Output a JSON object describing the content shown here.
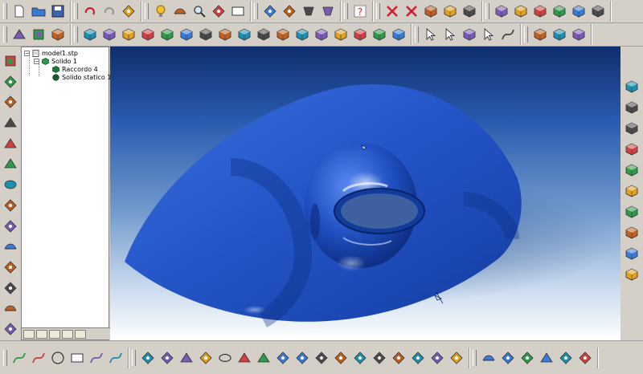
{
  "toolbar_top": [
    [
      "new-document-icon",
      "open-folder-icon",
      "save-icon"
    ],
    [
      "undo-icon",
      "redo-icon",
      "properties-icon"
    ],
    [
      "light-bulb-icon",
      "move-icon",
      "zoom-icon",
      "transform-icon",
      "grid-icon"
    ],
    [
      "render-icon",
      "wireframe-icon",
      "shaded-icon",
      "glasses-icon"
    ],
    [
      "help-icon"
    ],
    [
      "delete-red-icon",
      "delete-star-icon",
      "edit-solid-icon",
      "copy-solid-icon",
      "move-solid-icon"
    ],
    [
      "solid-view1-icon",
      "solid-view2-icon",
      "solid-view3-icon",
      "solid-view4-icon",
      "solid-view5-icon",
      "solid-view6-icon"
    ]
  ],
  "toolbar_second": [
    [
      "snap-icon",
      "section-icon",
      "solid-grid-icon"
    ],
    [
      "cube-1-icon",
      "cube-2-icon",
      "cube-3-icon",
      "cube-4-icon",
      "cube-5-icon",
      "cube-6-icon",
      "cube-7-icon",
      "cube-8-icon",
      "cube-9-icon",
      "cube-10-icon",
      "cube-11-icon",
      "cube-12-icon",
      "cube-13-icon",
      "cube-14-icon",
      "cube-15-icon",
      "cube-16-icon",
      "cube-17-icon"
    ],
    [
      "select-pointer-icon",
      "select-face-icon",
      "select-solid-icon",
      "select-edge-icon",
      "curve-icon"
    ],
    [
      "render-cube-1-icon",
      "render-cube-2-icon",
      "render-cube-3-icon"
    ]
  ],
  "toolbar_left": [
    "plane-icon",
    "face-icon",
    "shell-icon",
    "revolve-icon",
    "sweep-icon",
    "extrude-icon",
    "loft-icon",
    "boolean-icon",
    "fillet-icon",
    "chamfer-icon",
    "pattern-icon",
    "mirror-icon",
    "offset-icon",
    "split-icon"
  ],
  "toolbar_right": [
    "view-front-icon",
    "view-back-icon",
    "view-left-icon",
    "view-right-icon",
    "view-top-icon",
    "view-bottom-icon",
    "view-iso-icon",
    "view-cabinet-icon",
    "view-arch-icon",
    "view-box-icon"
  ],
  "toolbar_bottom": [
    [
      "curve-s-icon",
      "line-icon",
      "circle-icon",
      "rectangle-icon",
      "arc-icon",
      "spline-icon"
    ],
    [
      "surface-1-icon",
      "surface-2-icon",
      "polygon-icon",
      "surface-3-icon",
      "ellipse-icon",
      "surface-4-icon",
      "surface-5-icon",
      "cylinder-icon",
      "surface-6-icon",
      "surface-7-icon",
      "surface-8-icon",
      "surface-9-icon",
      "surface-10-icon",
      "surface-11-icon",
      "surface-12-icon",
      "surface-13-icon",
      "surface-14-icon"
    ],
    [
      "erase-icon",
      "dimension-icon",
      "constraint-icon",
      "measure-icon",
      "layer-icon",
      "export-icon"
    ]
  ],
  "tree": {
    "root": "model1.stp",
    "solid": "Solido 1",
    "fillet": "Raccordo 4",
    "static": "Solido statico 1"
  },
  "colors": {
    "toolbar": "#d4d0c8",
    "model_blue": "#2e62d4",
    "background_top": "#0e2e6e",
    "background_bottom": "#ffffff"
  }
}
